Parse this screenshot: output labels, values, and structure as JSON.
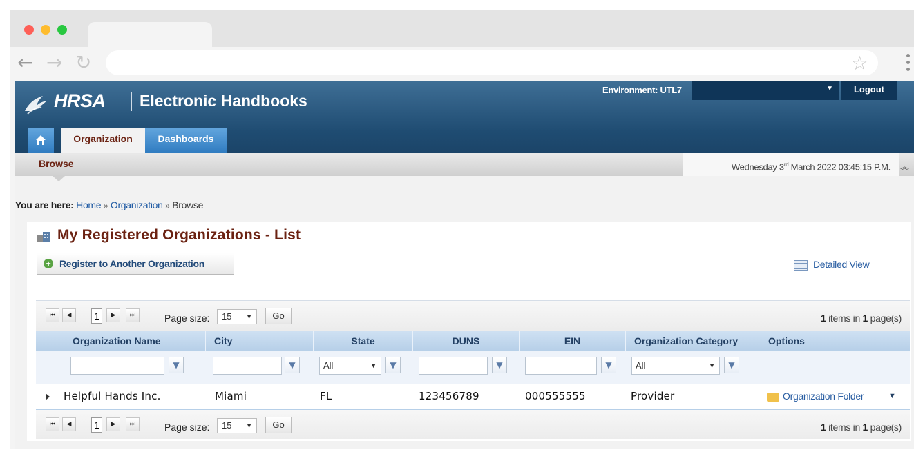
{
  "browser": {
    "traffic_colors": [
      "#fe5f57",
      "#febc2e",
      "#28c840"
    ]
  },
  "header": {
    "logo_text": "HRSA",
    "app_title": "Electronic Handbooks",
    "environment": "Environment: UTL7",
    "logout_label": "Logout",
    "tabs": [
      {
        "label": "Organization",
        "active": true
      },
      {
        "label": "Dashboards",
        "active": false
      }
    ],
    "home_icon": "home-icon"
  },
  "subnav": {
    "browse_label": "Browse",
    "date_prefix": "Wednesday 3",
    "date_sup": "rd",
    "date_suffix": " March 2022 03:45:15 P.M."
  },
  "breadcrumb": {
    "prefix": "You are here:",
    "items": [
      "Home",
      "Organization",
      "Browse"
    ],
    "separator": "»"
  },
  "content": {
    "title": "My Registered Organizations - List",
    "register_button": "Register to Another Organization",
    "detailed_view": "Detailed View"
  },
  "pager": {
    "current_page": "1",
    "page_size_label": "Page size:",
    "page_size": "15",
    "go_label": "Go",
    "items_count": "1",
    "items_mid": " items in ",
    "pages_count": "1",
    "pages_suffix": " page(s)"
  },
  "table": {
    "columns": [
      "Organization Name",
      "City",
      "State",
      "DUNS",
      "EIN",
      "Organization Category",
      "Options"
    ],
    "filters": {
      "state_value": "All",
      "category_value": "All"
    },
    "rows": [
      {
        "name": "Helpful Hands Inc.",
        "city": "Miami",
        "state": "FL",
        "duns": "123456789",
        "ein": "000555555",
        "category": "Provider",
        "option": "Organization Folder"
      }
    ]
  }
}
